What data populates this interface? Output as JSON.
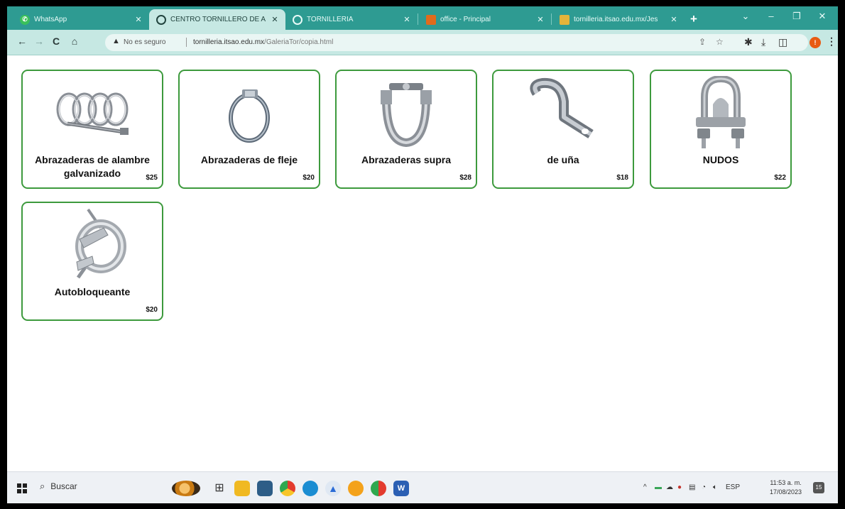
{
  "browser": {
    "tabs": [
      {
        "title": "WhatsApp",
        "icon": "whatsapp-icon"
      },
      {
        "title": "CENTRO TORNILLERO DE AL",
        "icon": "globe-icon",
        "active": true
      },
      {
        "title": "TORNILLERIA",
        "icon": "globe-icon"
      },
      {
        "title": "office - Principal",
        "icon": "office-icon"
      },
      {
        "title": "tornilleria.itsao.edu.mx/Jes",
        "icon": "bird-icon"
      }
    ],
    "new_tab": "+",
    "window_controls": {
      "dropdown": "⌄",
      "minimize": "–",
      "restore": "❐",
      "close": "✕"
    },
    "security_label": "No es seguro",
    "url_host": "tornilleria.itsao.edu.mx",
    "url_path": "/GaleriaTor/copia.html",
    "profile_initial": "!"
  },
  "products": [
    {
      "name": "Abrazaderas de alambre galvanizado",
      "price": "$25",
      "image": "wire-clamp-image"
    },
    {
      "name": "Abrazaderas de fleje",
      "price": "$20",
      "image": "hose-clamp-image"
    },
    {
      "name": "Abrazaderas supra",
      "price": "$28",
      "image": "heavy-clamp-image"
    },
    {
      "name": "de uña",
      "price": "$18",
      "image": "pipe-strap-image"
    },
    {
      "name": "NUDOS",
      "price": "$22",
      "image": "wire-rope-clip-image"
    },
    {
      "name": "Autobloqueante",
      "price": "$20",
      "image": "spring-clamp-image"
    }
  ],
  "taskbar": {
    "search_label": "Buscar",
    "language": "ESP",
    "time": "11:53 a. m.",
    "date": "17/08/2023",
    "notification_count": "15"
  },
  "colors": {
    "tab_bar": "#2e9b92",
    "toolbar": "#c6e8e3",
    "card_border": "#3d9a3d"
  }
}
